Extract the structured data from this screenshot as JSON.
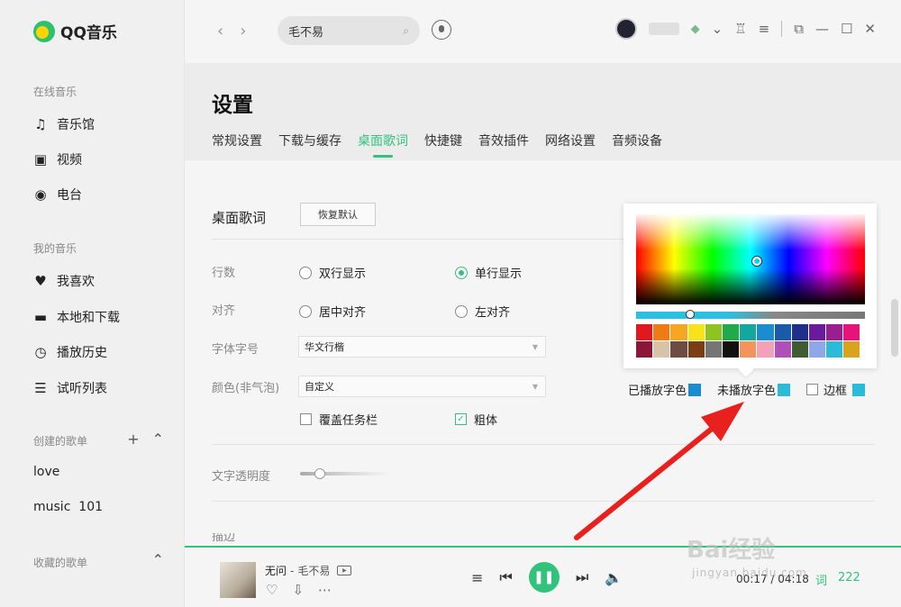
{
  "app": {
    "name": "QQ音乐"
  },
  "sidebar": {
    "online_title": "在线音乐",
    "online_items": [
      {
        "label": "音乐馆",
        "icon": "music-note-icon"
      },
      {
        "label": "视频",
        "icon": "video-icon"
      },
      {
        "label": "电台",
        "icon": "radio-icon"
      }
    ],
    "my_title": "我的音乐",
    "my_items": [
      {
        "label": "我喜欢",
        "icon": "heart-icon"
      },
      {
        "label": "本地和下载",
        "icon": "monitor-icon"
      },
      {
        "label": "播放历史",
        "icon": "clock-icon"
      },
      {
        "label": "试听列表",
        "icon": "playlist-icon"
      }
    ],
    "created_title": "创建的歌单",
    "playlists": [
      "love",
      "music  101"
    ],
    "collected_title": "收藏的歌单"
  },
  "topbar": {
    "search_value": "毛不易"
  },
  "settings": {
    "title": "设置",
    "tabs": [
      "常规设置",
      "下载与缓存",
      "桌面歌词",
      "快捷键",
      "音效插件",
      "网络设置",
      "音频设备"
    ],
    "active_tab": "桌面歌词",
    "section_title": "桌面歌词",
    "reset_label": "恢复默认",
    "rows": {
      "lines_label": "行数",
      "lines_options": [
        "双行显示",
        "单行显示"
      ],
      "lines_selected": "单行显示",
      "align_label": "对齐",
      "align_options": [
        "居中对齐",
        "左对齐"
      ],
      "font_label": "字体字号",
      "font_value": "华文行楷",
      "color_label": "颜色(非气泡)",
      "color_value": "自定义",
      "cover_taskbar": "覆盖任务栏",
      "bold": "粗体",
      "opacity_label": "文字透明度",
      "cut_label": "描边"
    }
  },
  "color_picker": {
    "swatches": [
      "#e0191e",
      "#ef7b13",
      "#f5a623",
      "#f7e21b",
      "#8fc31f",
      "#21a94a",
      "#13a89e",
      "#1a8ccf",
      "#1b5aa8",
      "#1e2f8e",
      "#6a1b9a",
      "#9b1d92",
      "#e4147c",
      "#8b1638",
      "#d7c3a5",
      "#6d4c41",
      "#7b3f14",
      "#757575",
      "#111111",
      "#f4935a",
      "#f3a1b9",
      "#b14fb9",
      "#3e5c2f",
      "#8fa7e6",
      "#2bbbd8",
      "#d8a41d"
    ],
    "played_label": "已播放字色",
    "played_color": "#1a8ccf",
    "unplayed_label": "未播放字色",
    "unplayed_color": "#2bbbd8",
    "border_label": "边框",
    "border_color": "#2bbbd8"
  },
  "player": {
    "title": "无问",
    "separator": "-",
    "artist": "毛不易",
    "time": "00:17 / 04:18",
    "lyric_btn": "词",
    "count": "222"
  },
  "watermark": {
    "text": "Bai经验",
    "sub": "jingyan.baidu.com"
  },
  "colors": {
    "accent": "#31c27c",
    "arrow": "#e8201e"
  }
}
